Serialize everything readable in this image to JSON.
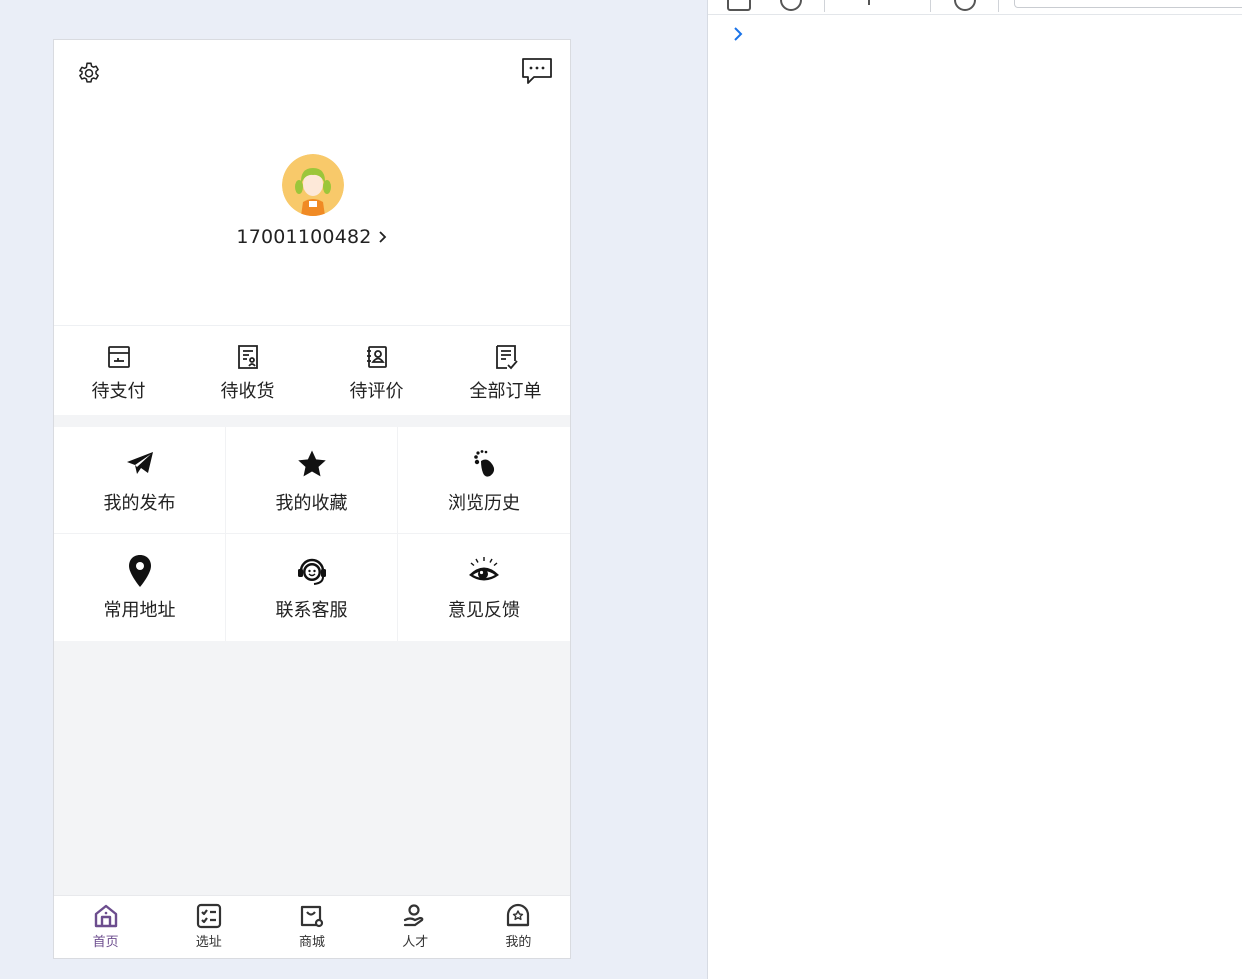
{
  "user": {
    "phone": "17001100482"
  },
  "orders": [
    {
      "label": "待支付",
      "icon": "wallet-icon"
    },
    {
      "label": "待收货",
      "icon": "receipt-person-icon"
    },
    {
      "label": "待评价",
      "icon": "contact-book-icon"
    },
    {
      "label": "全部订单",
      "icon": "checklist-icon"
    }
  ],
  "features": [
    {
      "label": "我的发布",
      "icon": "paper-plane-icon"
    },
    {
      "label": "我的收藏",
      "icon": "star-icon"
    },
    {
      "label": "浏览历史",
      "icon": "footprint-icon"
    },
    {
      "label": "常用地址",
      "icon": "location-pin-icon"
    },
    {
      "label": "联系客服",
      "icon": "customer-service-icon"
    },
    {
      "label": "意见反馈",
      "icon": "eye-feedback-icon"
    }
  ],
  "tabbar": {
    "active_index": 0,
    "active_color": "#6c4d8e",
    "items": [
      {
        "label": "首页",
        "icon": "home-icon"
      },
      {
        "label": "选址",
        "icon": "checklist-box-icon"
      },
      {
        "label": "商城",
        "icon": "shopping-bag-icon"
      },
      {
        "label": "人才",
        "icon": "person-hand-icon"
      },
      {
        "label": "我的",
        "icon": "profile-star-icon"
      }
    ]
  },
  "colors": {
    "page_background": "#eaeef7",
    "avatar_background": "#f8c96a",
    "text": "#222222",
    "devtools_prompt": "#1a73e8"
  }
}
